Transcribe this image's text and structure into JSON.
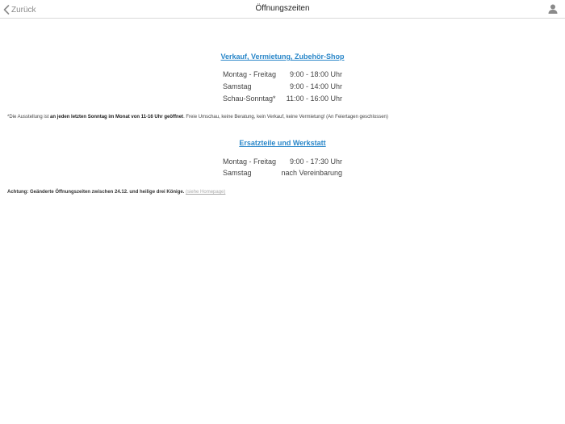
{
  "navbar": {
    "back_label": "Zurück",
    "title": "Öffnungszeiten"
  },
  "sales": {
    "title": "Verkauf, Vermietung, Zubehör-Shop",
    "rows": [
      {
        "day": "Montag - Freitag",
        "time": "9:00 - 18:00 Uhr"
      },
      {
        "day": "Samstag",
        "time": "9:00 - 14:00 Uhr"
      },
      {
        "day": "Schau-Sonntag*",
        "time": "11:00 - 16:00 Uhr"
      }
    ],
    "footnote": {
      "prefix": "*Die Ausstellung ist ",
      "bold": "an jeden letzten Sonntag im Monat von 11-16 Uhr geöffnet",
      "suffix": ". Freie Umschau, keine Beratung, kein Verkauf, keine Vermietung! (An Feiertagen geschlossen)"
    }
  },
  "workshop": {
    "title": "Ersatzteile und Werkstatt",
    "rows": [
      {
        "day": "Montag - Freitag",
        "time": "9:00 - 17:30 Uhr"
      },
      {
        "day": "Samstag",
        "time": "nach Vereinbarung"
      }
    ]
  },
  "notice": {
    "text": "Achtung: Geänderte Öffnungszeiten zwischen 24.12. und heilige drei Könige. ",
    "link": "(siehe Homepage)"
  },
  "colors": {
    "link": "#2a87c9",
    "muted": "#8a8a8a",
    "divider": "#d9d9d9"
  },
  "icons": {
    "back": "chevron-left-icon",
    "user": "user-icon"
  }
}
